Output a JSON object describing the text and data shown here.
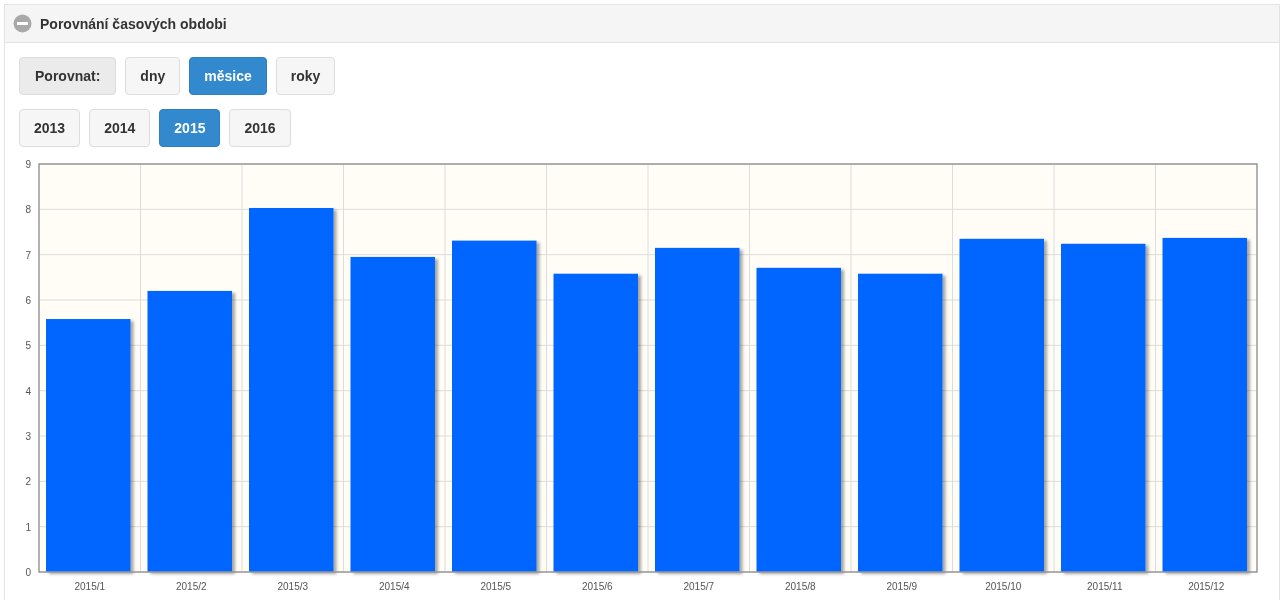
{
  "panel": {
    "title": "Porovnání časových obdobi",
    "expanded": true
  },
  "compare": {
    "label": "Porovnat:",
    "options": [
      {
        "label": "dny",
        "selected": false
      },
      {
        "label": "měsice",
        "selected": true
      },
      {
        "label": "roky",
        "selected": false
      }
    ]
  },
  "years": [
    {
      "label": "2013",
      "selected": false
    },
    {
      "label": "2014",
      "selected": false
    },
    {
      "label": "2015",
      "selected": true
    },
    {
      "label": "2016",
      "selected": false
    }
  ],
  "chart_data": {
    "type": "bar",
    "categories": [
      "2015/1",
      "2015/2",
      "2015/3",
      "2015/4",
      "2015/5",
      "2015/6",
      "2015/7",
      "2015/8",
      "2015/9",
      "2015/10",
      "2015/11",
      "2015/12"
    ],
    "values": [
      5.58,
      6.2,
      8.03,
      6.95,
      7.31,
      6.58,
      7.15,
      6.71,
      6.58,
      7.35,
      7.24,
      7.37
    ],
    "grid": true,
    "ylim": [
      0,
      9
    ],
    "yticks": [
      0,
      1,
      2,
      3,
      4,
      5,
      6,
      7,
      8,
      9
    ]
  }
}
